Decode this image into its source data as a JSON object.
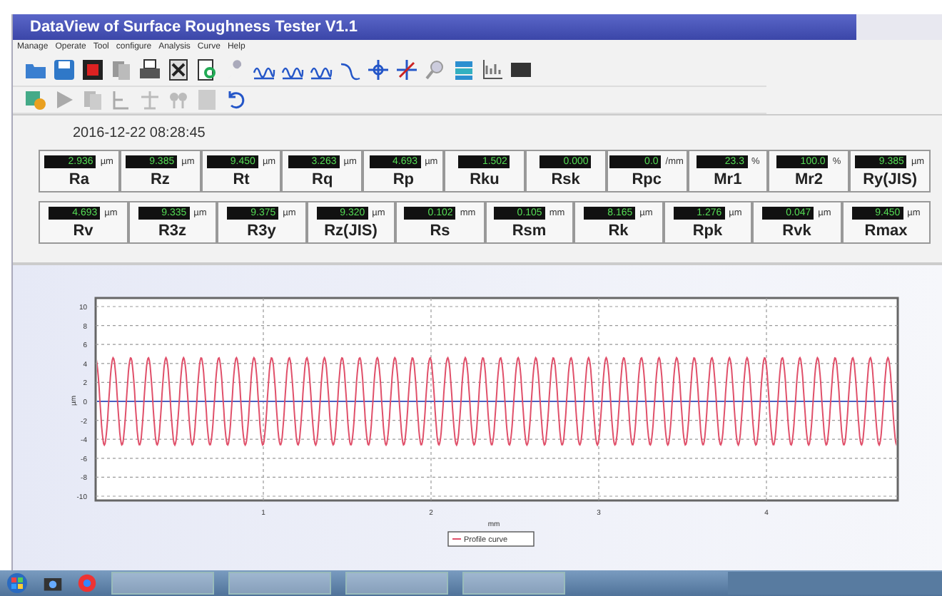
{
  "window": {
    "title": "DataView of Surface Roughness Tester  V1.1"
  },
  "menu": [
    "Manage",
    "Operate",
    "Tool",
    "configure",
    "Analysis",
    "Curve",
    "Help"
  ],
  "timestamp": "2016-12-22 08:28:45",
  "parameter_rows": [
    [
      {
        "value": "2.936",
        "unit": "µm",
        "label": "Ra"
      },
      {
        "value": "9.385",
        "unit": "µm",
        "label": "Rz"
      },
      {
        "value": "9.450",
        "unit": "µm",
        "label": "Rt"
      },
      {
        "value": "3.263",
        "unit": "µm",
        "label": "Rq"
      },
      {
        "value": "4.693",
        "unit": "µm",
        "label": "Rp"
      },
      {
        "value": "1.502",
        "label": "Rku"
      },
      {
        "value": "0.000",
        "label": "Rsk"
      },
      {
        "value": "0.0",
        "unit": "/mm",
        "label": "Rpc"
      },
      {
        "value": "23.3",
        "unit": "%",
        "label": "Mr1"
      },
      {
        "value": "100.0",
        "unit": "%",
        "label": "Mr2"
      },
      {
        "value": "9.385",
        "unit": "µm",
        "label": "Ry(JIS)"
      }
    ],
    [
      {
        "value": "4.693",
        "unit": "µm",
        "label": "Rv"
      },
      {
        "value": "9.335",
        "unit": "µm",
        "label": "R3z"
      },
      {
        "value": "9.375",
        "unit": "µm",
        "label": "R3y"
      },
      {
        "value": "9.320",
        "unit": "µm",
        "label": "Rz(JIS)"
      },
      {
        "value": "0.102",
        "unit": "mm",
        "label": "Rs"
      },
      {
        "value": "0.105",
        "unit": "mm",
        "label": "Rsm"
      },
      {
        "value": "8.165",
        "unit": "µm",
        "label": "Rk"
      },
      {
        "value": "1.276",
        "unit": "µm",
        "label": "Rpk"
      },
      {
        "value": "0.047",
        "unit": "µm",
        "label": "Rvk"
      },
      {
        "value": "9.450",
        "unit": "µm",
        "label": "Rmax"
      }
    ]
  ],
  "chart": {
    "yticks": [
      "10",
      "8",
      "6",
      "4",
      "2",
      "0",
      "-2",
      "-4",
      "-6",
      "-8",
      "-10"
    ],
    "xticks": [
      "1",
      "2",
      "3",
      "4"
    ],
    "xlabel": "mm",
    "ylabel": "µm",
    "legend": "Profile curve"
  }
}
